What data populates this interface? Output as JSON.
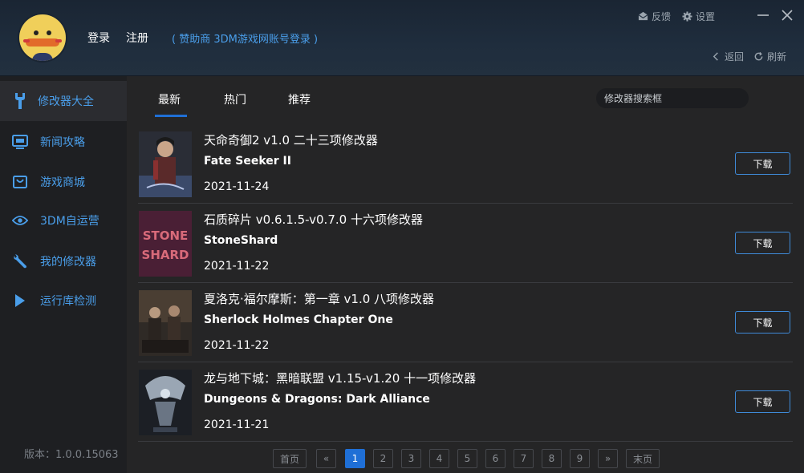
{
  "header": {
    "login": "登录",
    "register": "注册",
    "sponsor": "( 赞助商 3DM游戏网账号登录 )",
    "feedback": "反馈",
    "settings": "设置",
    "back": "返回",
    "refresh": "刷新"
  },
  "sidebar": {
    "items": [
      {
        "label": "修改器大全",
        "icon": "wrench-icon"
      },
      {
        "label": "新闻攻略",
        "icon": "news-icon"
      },
      {
        "label": "游戏商城",
        "icon": "store-icon"
      },
      {
        "label": "3DM自运营",
        "icon": "eye-icon"
      },
      {
        "label": "我的修改器",
        "icon": "tools-icon"
      },
      {
        "label": "运行库检测",
        "icon": "play-icon"
      }
    ],
    "version": "版本：1.0.0.15063"
  },
  "tabs": [
    {
      "label": "最新"
    },
    {
      "label": "热门"
    },
    {
      "label": "推荐"
    }
  ],
  "search": {
    "placeholder": "修改器搜索框"
  },
  "list": [
    {
      "title": "天命奇御2 v1.0 二十三项修改器",
      "en": "Fate Seeker II",
      "date": "2021-11-24",
      "download": "下载"
    },
    {
      "title": "石质碎片 v0.6.1.5-v0.7.0 十六项修改器",
      "en": "StoneShard",
      "date": "2021-11-22",
      "download": "下载"
    },
    {
      "title": "夏洛克·福尔摩斯：第一章 v1.0 八项修改器",
      "en": "Sherlock Holmes Chapter One",
      "date": "2021-11-22",
      "download": "下载"
    },
    {
      "title": "龙与地下城：黑暗联盟 v1.15-v1.20 十一项修改器",
      "en": "Dungeons & Dragons: Dark Alliance",
      "date": "2021-11-21",
      "download": "下载"
    }
  ],
  "pager": {
    "first": "首页",
    "prev": "«",
    "pages": [
      "1",
      "2",
      "3",
      "4",
      "5",
      "6",
      "7",
      "8",
      "9"
    ],
    "next": "»",
    "last": "末页",
    "current": "1"
  },
  "colors": {
    "accent": "#1f6fd6",
    "link": "#4a9eea",
    "background": "#252526",
    "sidebar": "#1e1f22"
  }
}
